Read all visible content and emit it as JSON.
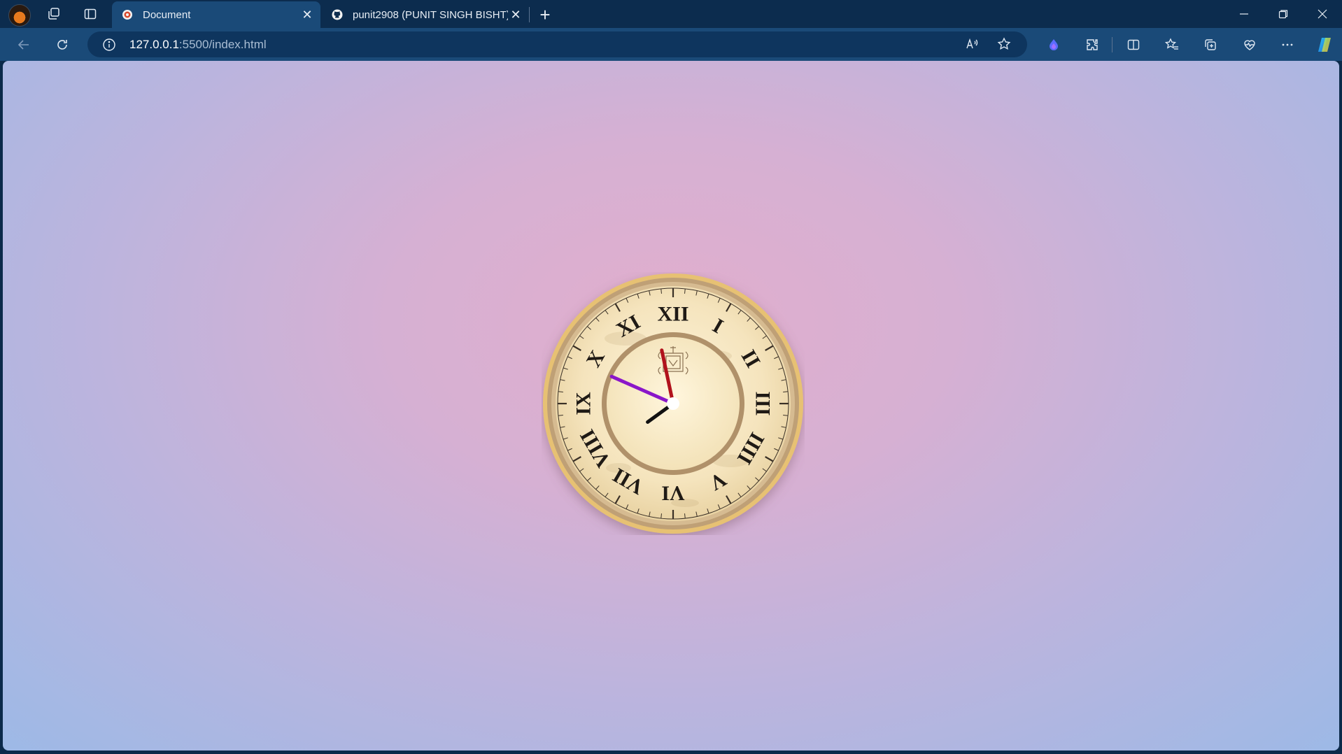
{
  "browser": {
    "tabs": [
      {
        "label": "Document",
        "active": true,
        "favicon": "live-server-icon"
      },
      {
        "label": "punit2908 (PUNIT SINGH BISHT)",
        "active": false,
        "favicon": "github-icon"
      }
    ],
    "url": {
      "host": "127.0.0.1",
      "rest": ":5500/index.html"
    }
  },
  "page": {
    "background_colors": [
      "#e1aecd",
      "#d6b0d3",
      "#bdb4dd",
      "#9db9e6"
    ],
    "clock": {
      "numerals": [
        "XII",
        "I",
        "II",
        "III",
        "IIII",
        "V",
        "VI",
        "VII",
        "VIII",
        "IX",
        "X",
        "XI"
      ],
      "time_shown": {
        "hours": 7,
        "minutes": 48,
        "seconds": 58
      },
      "hand_colors": {
        "hour": "#111111",
        "minute": "#8a16c9",
        "second": "#b1121c"
      },
      "face_color": "#f7e8c4",
      "rim_color": "#e6c27a"
    }
  }
}
